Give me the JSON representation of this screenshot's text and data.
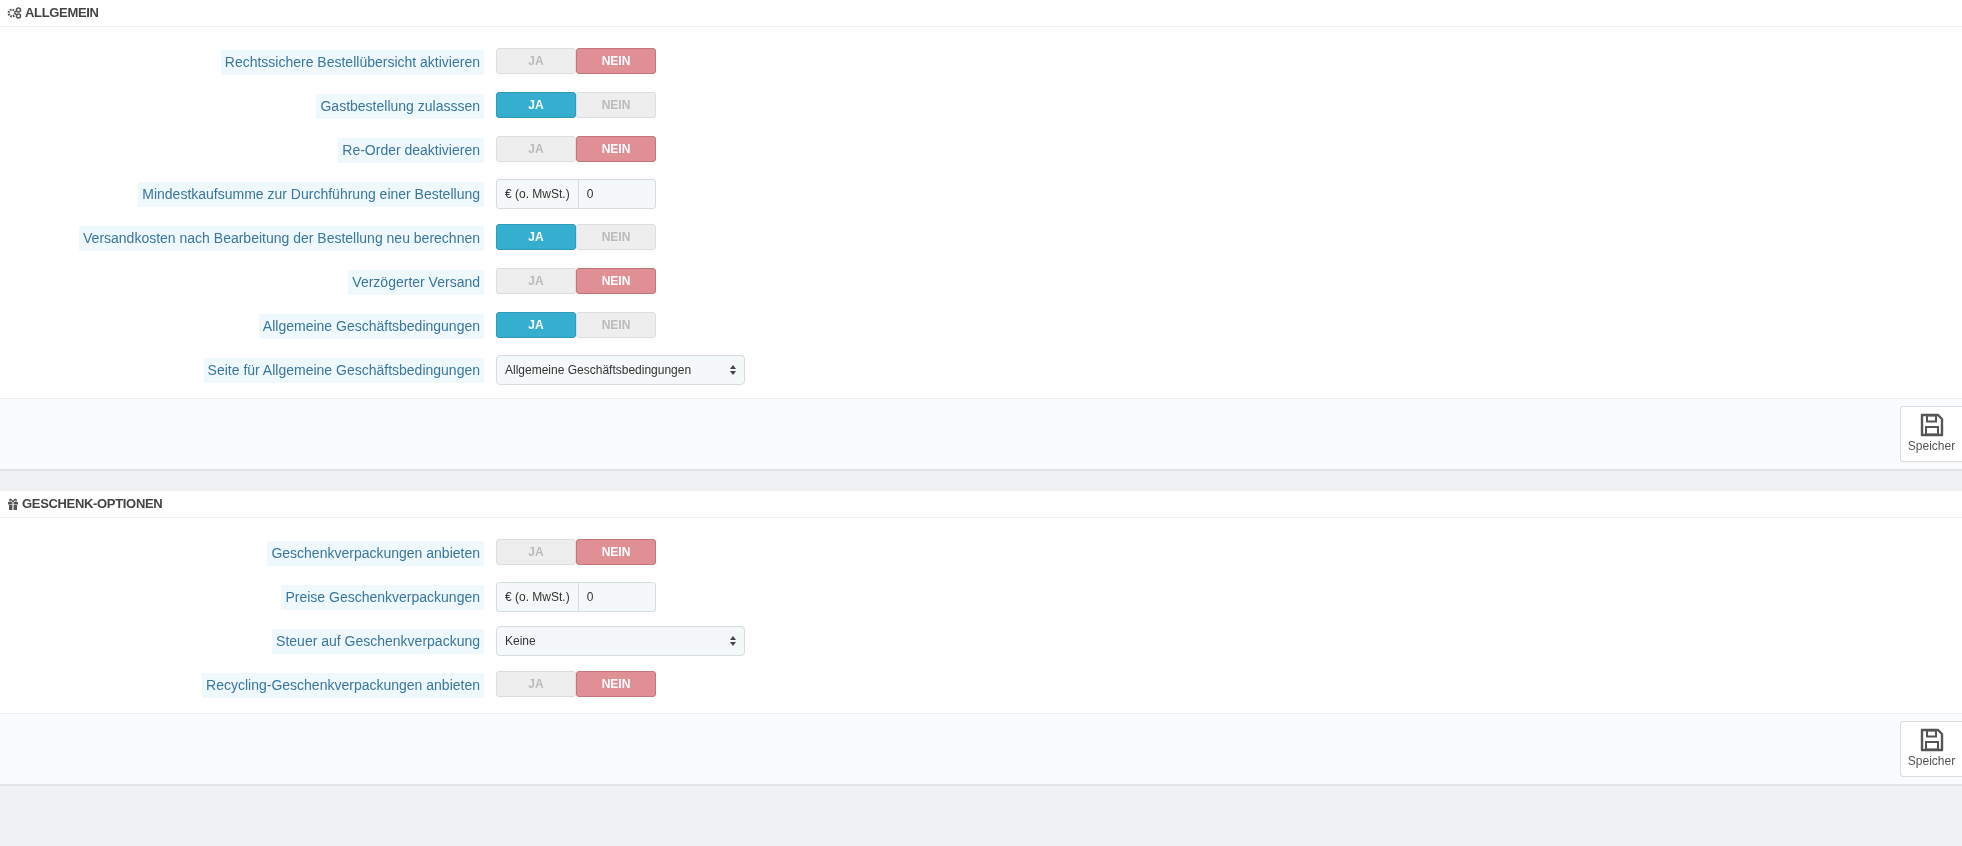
{
  "sections": [
    {
      "title": "ALLGEMEIN",
      "fields": [
        {
          "kind": "toggle",
          "label": "Rechtssichere Bestellübersicht aktivieren",
          "options": [
            {
              "label": "JA",
              "selected": false
            },
            {
              "label": "NEIN",
              "selected": true
            }
          ]
        },
        {
          "kind": "toggle",
          "label": "Gastbestellung zulasssen",
          "options": [
            {
              "label": "JA",
              "selected": true
            },
            {
              "label": "NEIN",
              "selected": false
            }
          ]
        },
        {
          "kind": "toggle",
          "label": "Re-Order deaktivieren",
          "options": [
            {
              "label": "JA",
              "selected": false
            },
            {
              "label": "NEIN",
              "selected": true
            }
          ]
        },
        {
          "kind": "money",
          "label": "Mindestkaufsumme zur Durchführung einer Bestellung",
          "prefix": "€ (o. MwSt.)",
          "value": "0"
        },
        {
          "kind": "toggle",
          "label": "Versandkosten nach Bearbeitung der Bestellung neu berechnen",
          "options": [
            {
              "label": "JA",
              "selected": true
            },
            {
              "label": "NEIN",
              "selected": false
            }
          ]
        },
        {
          "kind": "toggle",
          "label": "Verzögerter Versand",
          "options": [
            {
              "label": "JA",
              "selected": false
            },
            {
              "label": "NEIN",
              "selected": true
            }
          ]
        },
        {
          "kind": "toggle",
          "label": "Allgemeine Geschäftsbedingungen",
          "options": [
            {
              "label": "JA",
              "selected": true
            },
            {
              "label": "NEIN",
              "selected": false
            }
          ]
        },
        {
          "kind": "select",
          "label": "Seite für Allgemeine Geschäftsbedingungen",
          "value": "Allgemeine Geschäftsbedingungen"
        }
      ],
      "save_button": "Speicher"
    },
    {
      "title": "GESCHENK-OPTIONEN",
      "fields": [
        {
          "kind": "toggle",
          "label": "Geschenkverpackungen anbieten",
          "options": [
            {
              "label": "JA",
              "selected": false
            },
            {
              "label": "NEIN",
              "selected": true
            }
          ]
        },
        {
          "kind": "money",
          "label": "Preise Geschenkverpackungen",
          "prefix": "€ (o. MwSt.)",
          "value": "0"
        },
        {
          "kind": "select",
          "label": "Steuer auf Geschenkverpackung",
          "value": "Keine"
        },
        {
          "kind": "toggle",
          "label": "Recycling-Geschenkverpackungen anbieten",
          "options": [
            {
              "label": "JA",
              "selected": false
            },
            {
              "label": "NEIN",
              "selected": true
            }
          ]
        }
      ],
      "save_button": "Speicher"
    }
  ]
}
